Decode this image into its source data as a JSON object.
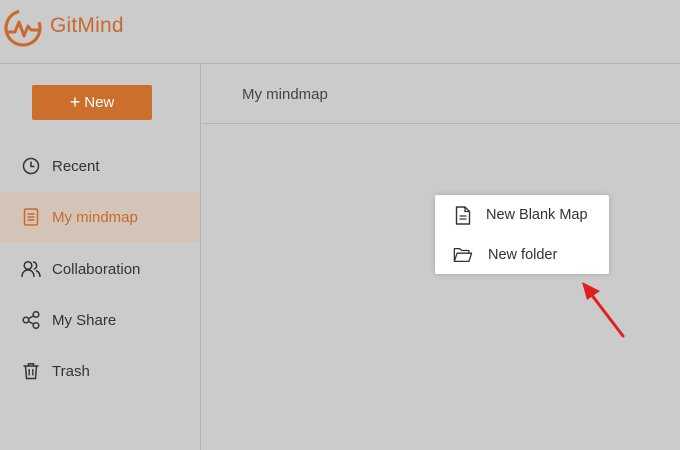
{
  "header": {
    "brand": "GitMind"
  },
  "sidebar": {
    "new_button": {
      "plus": "+",
      "label": "New"
    },
    "items": [
      {
        "label": "Recent",
        "icon": "clock-icon",
        "active": false
      },
      {
        "label": "My mindmap",
        "icon": "document-icon",
        "active": true
      },
      {
        "label": "Collaboration",
        "icon": "users-icon",
        "active": false
      },
      {
        "label": "My Share",
        "icon": "share-icon",
        "active": false
      },
      {
        "label": "Trash",
        "icon": "trash-icon",
        "active": false
      }
    ]
  },
  "main": {
    "title": "My mindmap"
  },
  "context_menu": {
    "items": [
      {
        "label": "New Blank Map",
        "icon": "file-icon"
      },
      {
        "label": "New folder",
        "icon": "folder-open-icon"
      }
    ]
  },
  "colors": {
    "accent": "#cc6e2c",
    "background": "#cbcbcb",
    "active_item_bg": "#d4c4b7",
    "annotation_arrow": "#e0201e"
  }
}
